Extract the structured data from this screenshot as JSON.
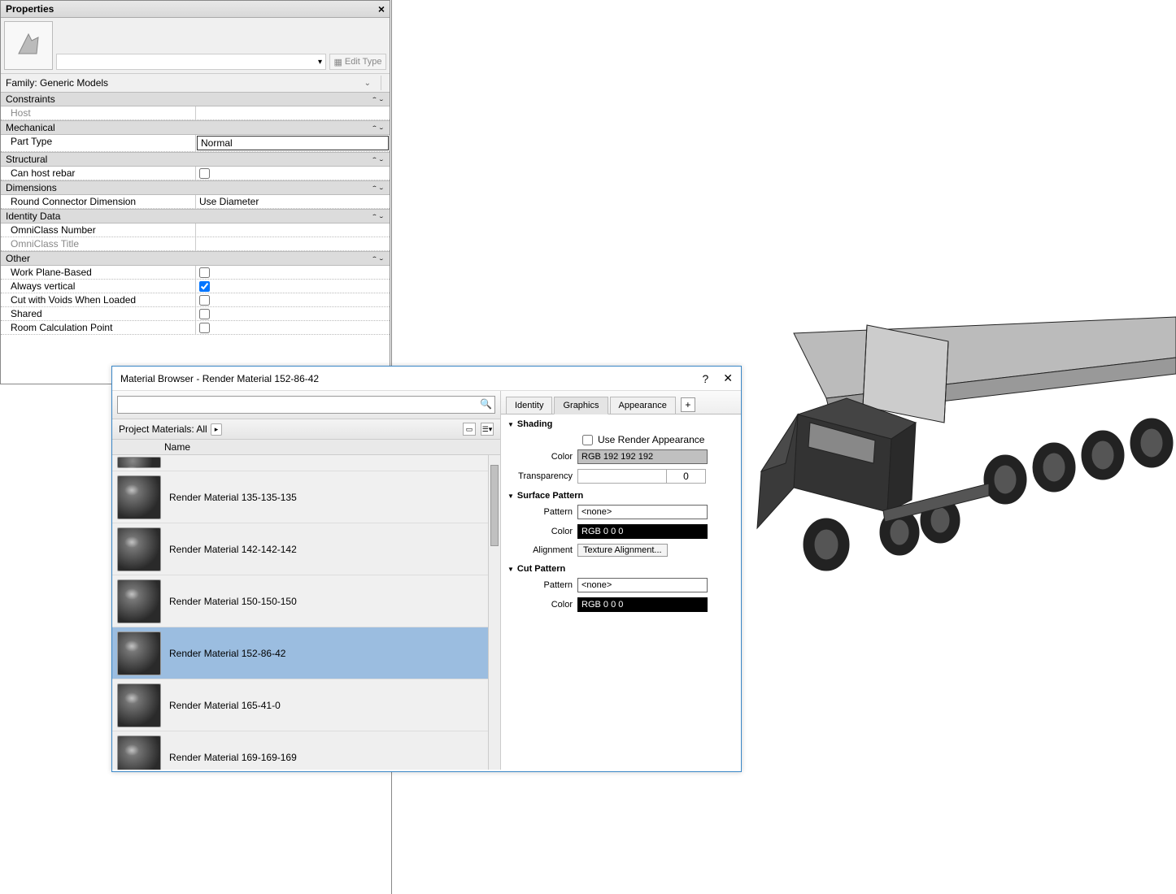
{
  "properties": {
    "title": "Properties",
    "family_label": "Family: Generic Models",
    "edit_type": "Edit Type",
    "categories": [
      {
        "name": "Constraints",
        "rows": [
          {
            "label": "Host",
            "value": "",
            "type": "text",
            "readonly": true
          }
        ]
      },
      {
        "name": "Mechanical",
        "rows": [
          {
            "label": "Part Type",
            "value": "Normal",
            "type": "boxed"
          }
        ]
      },
      {
        "name": "Structural",
        "rows": [
          {
            "label": "Can host rebar",
            "value": false,
            "type": "check"
          }
        ]
      },
      {
        "name": "Dimensions",
        "rows": [
          {
            "label": "Round Connector Dimension",
            "value": "Use Diameter",
            "type": "text"
          }
        ]
      },
      {
        "name": "Identity Data",
        "rows": [
          {
            "label": "OmniClass Number",
            "value": "",
            "type": "text"
          },
          {
            "label": "OmniClass Title",
            "value": "",
            "type": "text",
            "readonly": true
          }
        ]
      },
      {
        "name": "Other",
        "rows": [
          {
            "label": "Work Plane-Based",
            "value": false,
            "type": "check"
          },
          {
            "label": "Always vertical",
            "value": true,
            "type": "check"
          },
          {
            "label": "Cut with Voids When Loaded",
            "value": false,
            "type": "check"
          },
          {
            "label": "Shared",
            "value": false,
            "type": "check"
          },
          {
            "label": "Room Calculation Point",
            "value": false,
            "type": "check"
          }
        ]
      }
    ]
  },
  "material_browser": {
    "title": "Material Browser - Render Material 152-86-42",
    "search_value": "",
    "filter_label": "Project Materials: All",
    "name_header": "Name",
    "materials": [
      {
        "name": "",
        "partial": true
      },
      {
        "name": "Render Material 135-135-135"
      },
      {
        "name": "Render Material 142-142-142"
      },
      {
        "name": "Render Material 150-150-150"
      },
      {
        "name": "Render Material 152-86-42",
        "selected": true
      },
      {
        "name": "Render Material 165-41-0"
      },
      {
        "name": "Render Material 169-169-169"
      }
    ],
    "tabs": {
      "identity": "Identity",
      "graphics": "Graphics",
      "appearance": "Appearance"
    },
    "shading": {
      "title": "Shading",
      "use_render": "Use Render Appearance",
      "use_render_checked": false,
      "color_label": "Color",
      "color_value": "RGB 192 192 192",
      "transparency_label": "Transparency",
      "transparency_value": "0"
    },
    "surface_pattern": {
      "title": "Surface Pattern",
      "pattern_label": "Pattern",
      "pattern_value": "<none>",
      "color_label": "Color",
      "color_value": "RGB 0 0 0",
      "alignment_label": "Alignment",
      "alignment_value": "Texture Alignment..."
    },
    "cut_pattern": {
      "title": "Cut Pattern",
      "pattern_label": "Pattern",
      "pattern_value": "<none>",
      "color_label": "Color",
      "color_value": "RGB 0 0 0"
    }
  }
}
